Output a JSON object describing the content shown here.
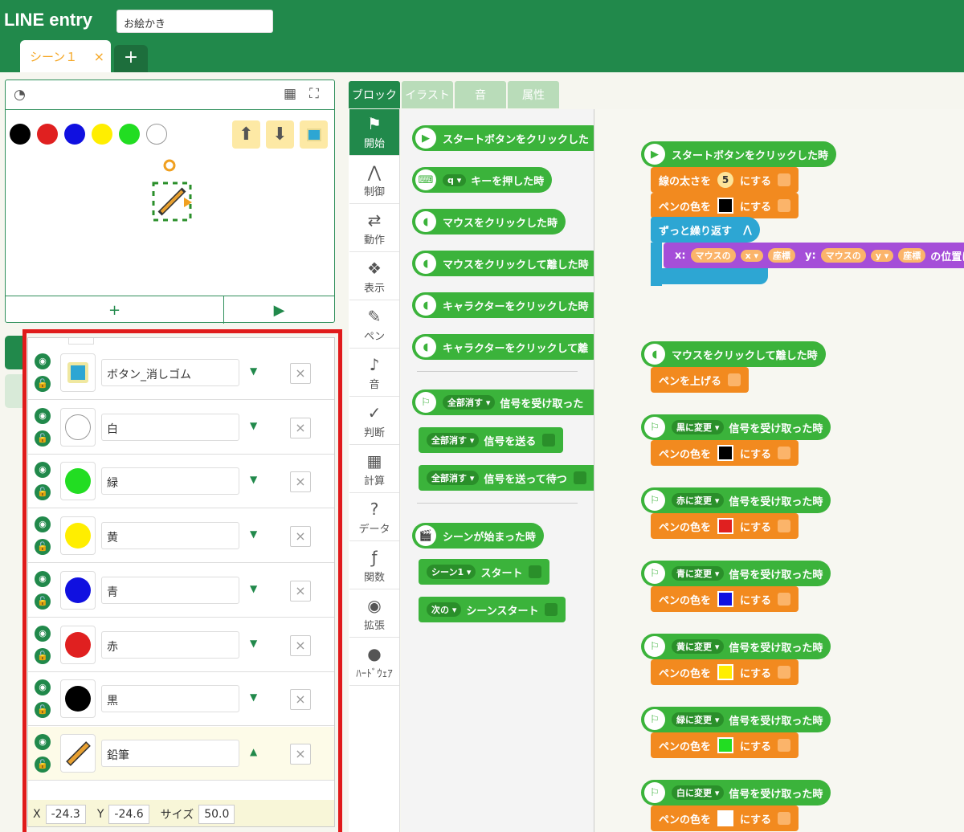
{
  "app": {
    "logo": "LINE entry",
    "project_name": "お絵かき"
  },
  "scene_tab": {
    "label": "シーン１",
    "close": "×",
    "add": "+"
  },
  "stage": {
    "colors": [
      "#000000",
      "#e02020",
      "#1010e0",
      "#ffee00",
      "#22dd22",
      "#ffffff"
    ],
    "add_label": "+",
    "play_label": "▶"
  },
  "objects": [
    {
      "name": "ボタン_消しゴム",
      "thumb_color": "#f0e8a0",
      "arrow": "▼",
      "delete": "×"
    },
    {
      "name": "白",
      "thumb_color": "#ffffff",
      "arrow": "▼",
      "delete": "×"
    },
    {
      "name": "緑",
      "thumb_color": "#22dd22",
      "arrow": "▼",
      "delete": "×"
    },
    {
      "name": "黄",
      "thumb_color": "#ffee00",
      "arrow": "▼",
      "delete": "×"
    },
    {
      "name": "青",
      "thumb_color": "#1010e0",
      "arrow": "▼",
      "delete": "×"
    },
    {
      "name": "赤",
      "thumb_color": "#e02020",
      "arrow": "▼",
      "delete": "×"
    },
    {
      "name": "黒",
      "thumb_color": "#000000",
      "arrow": "▼",
      "delete": "×"
    },
    {
      "name": "鉛筆",
      "thumb_color": "pencil",
      "arrow": "▲",
      "delete": "×"
    }
  ],
  "coords": {
    "x_label": "X",
    "x_value": "-24.3",
    "y_label": "Y",
    "y_value": "-24.6",
    "size_label": "サイズ",
    "size_value": "50.0"
  },
  "tabs": [
    "ブロック",
    "イラスト",
    "音",
    "属性"
  ],
  "categories": [
    {
      "label": "開始",
      "icon": "⚑"
    },
    {
      "label": "制御",
      "icon": "⋀"
    },
    {
      "label": "動作",
      "icon": "⇄"
    },
    {
      "label": "表示",
      "icon": "❖"
    },
    {
      "label": "ペン",
      "icon": "✎"
    },
    {
      "label": "音",
      "icon": "♪"
    },
    {
      "label": "判断",
      "icon": "✓"
    },
    {
      "label": "計算",
      "icon": "▦"
    },
    {
      "label": "データ",
      "icon": "?"
    },
    {
      "label": "関数",
      "icon": "ƒ"
    },
    {
      "label": "拡張",
      "icon": "◉"
    },
    {
      "label": "ﾊｰﾄﾞｳｪｱ",
      "icon": "●"
    }
  ],
  "palette": {
    "b1": "スタートボタンをクリックした",
    "b2_pill": "q ▾",
    "b2": "キーを押した時",
    "b3": "マウスをクリックした時",
    "b4": "マウスをクリックして離した時",
    "b5": "キャラクターをクリックした時",
    "b6": "キャラクターをクリックして離",
    "b7_pill": "全部消す ▾",
    "b7": "信号を受け取った",
    "b8_pill": "全部消す ▾",
    "b8": "信号を送る",
    "b9_pill": "全部消す ▾",
    "b9": "信号を送って待つ",
    "b10": "シーンが始まった時",
    "b11_pill": "シーン1 ▾",
    "b11": "スタート",
    "b12_pill": "次の ▾",
    "b12": "シーンスタート"
  },
  "script": {
    "start": "スタートボタンをクリックした時",
    "thick_label": "線の太さを",
    "thick_val": "5",
    "suru": "にする",
    "pen_color": "ペンの色を",
    "forever": "ずっと繰り返す",
    "x_label": "x:",
    "mouse": "マウスの",
    "x_pill": "x ▾",
    "coord": "座標",
    "y_label": "y:",
    "y_pill": "y ▾",
    "pos": "の位置に",
    "mouse_release": "マウスをクリックして離した時",
    "pen_up": "ペンを上げる",
    "recv": "信号を受け取った時",
    "signals": [
      "黒に変更 ▾",
      "赤に変更 ▾",
      "青に変更 ▾",
      "黄に変更 ▾",
      "緑に変更 ▾",
      "白に変更 ▾"
    ],
    "signal_colors": [
      "#000000",
      "#e02020",
      "#1010e0",
      "#ffee00",
      "#22dd22",
      "#ffffff"
    ]
  }
}
